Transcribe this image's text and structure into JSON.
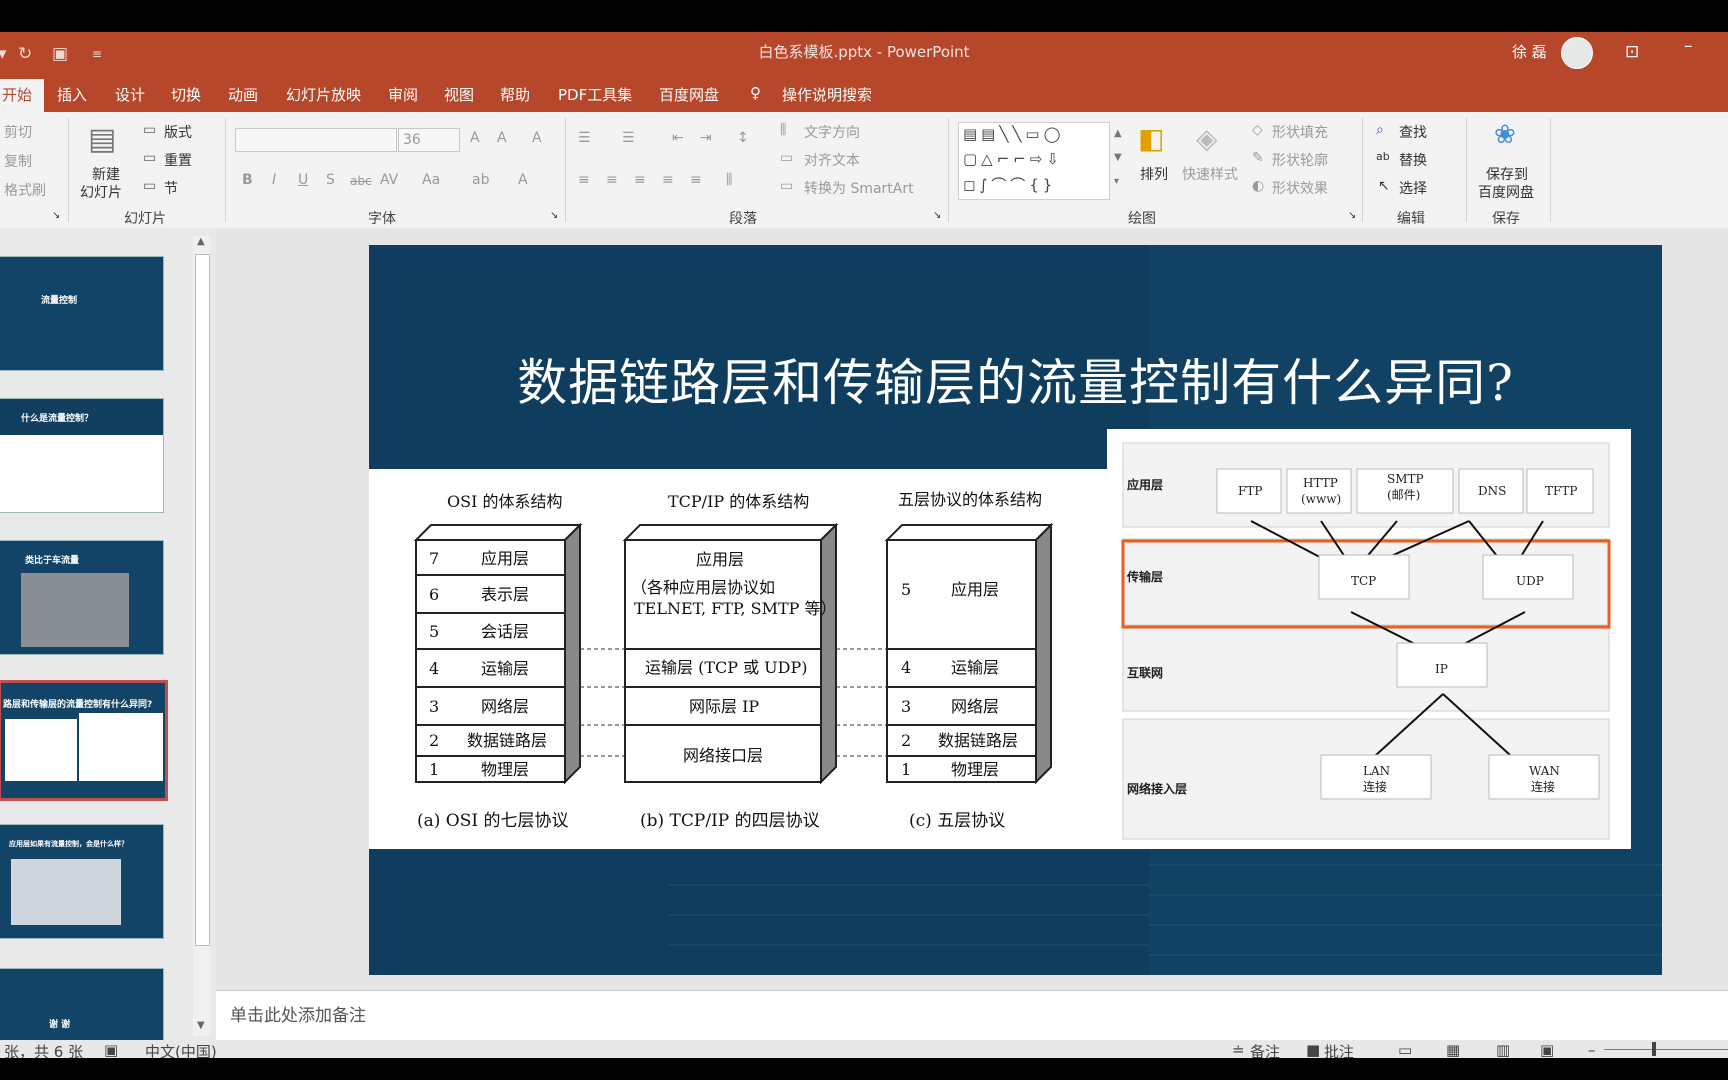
{
  "window": {
    "doc_title": "白色系模板.pptx  -  PowerPoint",
    "user_name": "徐 磊"
  },
  "tabs": [
    "开始",
    "插入",
    "设计",
    "切换",
    "动画",
    "幻灯片放映",
    "审阅",
    "视图",
    "帮助",
    "PDF工具集",
    "百度网盘"
  ],
  "tell_me": "操作说明搜索",
  "ribbon": {
    "clipboard": {
      "cut": "剪切",
      "copy": "复制",
      "format_painter": "格式刷"
    },
    "slides": {
      "new_slide_1": "新建",
      "new_slide_2": "幻灯片",
      "layout": "版式",
      "reset": "重置",
      "section": "节",
      "group": "幻灯片"
    },
    "font": {
      "font_name": "",
      "font_size": "36",
      "group": "字体"
    },
    "paragraph": {
      "text_direction": "文字方向",
      "align_text": "对齐文本",
      "smartart": "转换为 SmartArt",
      "group": "段落"
    },
    "drawing": {
      "arrange": "排列",
      "quick_styles": "快速样式",
      "shape_fill": "形状填充",
      "shape_outline": "形状轮廓",
      "shape_effects": "形状效果",
      "group": "绘图"
    },
    "editing": {
      "find": "查找",
      "replace": "替换",
      "select": "选择",
      "group": "编辑"
    },
    "save": {
      "save_to_1": "保存到",
      "save_to_2": "百度网盘",
      "group": "保存"
    }
  },
  "thumbnails": [
    {
      "title": "流量控制",
      "bg": "#123f5f"
    },
    {
      "title": "什么是流量控制？",
      "bg": "#123f5f"
    },
    {
      "title": "类比于车流量",
      "bg": "#123f5f"
    },
    {
      "title": "路层和传输层的流量控制有什么异同?",
      "bg": "#123f5f"
    },
    {
      "title": "应用层如果有流量控制，会是什么样？",
      "bg": "#123f5f"
    },
    {
      "title": "谢  谢",
      "bg": "#123f5f"
    }
  ],
  "slide": {
    "title": "数据链路层和传输层的流量控制有什么异同?",
    "osi": {
      "header": "OSI 的体系结构",
      "layers": [
        {
          "num": "7",
          "name": "应用层"
        },
        {
          "num": "6",
          "name": "表示层"
        },
        {
          "num": "5",
          "name": "会话层"
        },
        {
          "num": "4",
          "name": "运输层"
        },
        {
          "num": "3",
          "name": "网络层"
        },
        {
          "num": "2",
          "name": "数据链路层"
        },
        {
          "num": "1",
          "name": "物理层"
        }
      ],
      "caption": "(a) OSI 的七层协议"
    },
    "tcpip": {
      "header": "TCP/IP 的体系结构",
      "app_1": "应用层",
      "app_2": "（各种应用层协议如",
      "app_3": "TELNET, FTP, SMTP 等）",
      "transport": "运输层 (TCP 或 UDP)",
      "internet": "网际层 IP",
      "netif": "网络接口层",
      "caption": "(b) TCP/IP 的四层协议"
    },
    "five": {
      "header": "五层协议的体系结构",
      "layers": [
        {
          "num": "5",
          "name": "应用层"
        },
        {
          "num": "4",
          "name": "运输层"
        },
        {
          "num": "3",
          "name": "网络层"
        },
        {
          "num": "2",
          "name": "数据链路层"
        },
        {
          "num": "1",
          "name": "物理层"
        }
      ],
      "caption": "(c)  五层协议"
    },
    "tcp_diagram": {
      "rows": {
        "app": "应用层",
        "transport": "传输层",
        "internet": "互联网",
        "access": "网络接入层"
      },
      "protocols": {
        "ftp": "FTP",
        "http_1": "HTTP",
        "http_2": "(www)",
        "smtp_1": "SMTP",
        "smtp_2": "(邮件)",
        "dns": "DNS",
        "tftp": "TFTP",
        "tcp": "TCP",
        "udp": "UDP",
        "ip": "IP",
        "lan_1": "LAN",
        "lan_2": "连接",
        "wan_1": "WAN",
        "wan_2": "连接"
      },
      "highlight_color": "#e8601c"
    }
  },
  "notes": "单击此处添加备注",
  "status": {
    "slide_of": "张，共 6 张",
    "language": "中文(中国)",
    "notes_btn": "备注",
    "comments_btn": "批注"
  }
}
